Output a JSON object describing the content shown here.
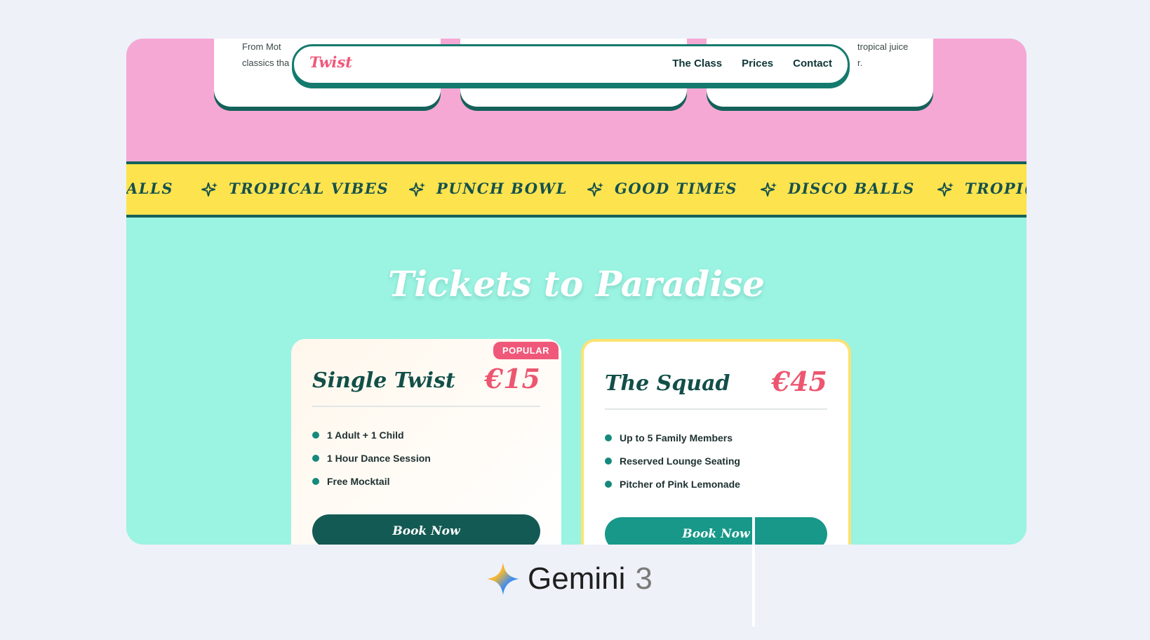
{
  "top_cards": [
    {
      "line1": "From Mot",
      "line2": "classics tha"
    },
    {
      "line1": "",
      "line2": ""
    },
    {
      "line1": "tropical juice",
      "line2": "r."
    }
  ],
  "nav": {
    "brand": "Twist",
    "links": [
      "The Class",
      "Prices",
      "Contact"
    ]
  },
  "ticker": {
    "items": [
      "ALLS",
      "TROPICAL VIBES",
      "PUNCH BOWL",
      "GOOD TIMES",
      "DISCO BALLS",
      "TROPI("
    ]
  },
  "section": {
    "title": "Tickets to Paradise"
  },
  "tickets": [
    {
      "badge": "POPULAR",
      "name": "Single Twist",
      "price": "€15",
      "features": [
        "1 Adult + 1 Child",
        "1 Hour Dance Session",
        "Free Mocktail"
      ],
      "button": "Book Now"
    },
    {
      "name": "The Squad",
      "price": "€45",
      "features": [
        "Up to 5 Family Members",
        "Reserved Lounge Seating",
        "Pitcher of Pink Lemonade"
      ],
      "button": "Book Now"
    }
  ],
  "branding": {
    "name": "Gemini",
    "version": "3"
  },
  "colors": {
    "pink": "#f6a8d4",
    "mint": "#9bf3e2",
    "yellow": "#fde34e",
    "teal_dark": "#15615a",
    "accent_red": "#f0587a"
  }
}
